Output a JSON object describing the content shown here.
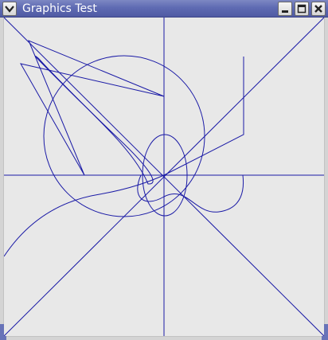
{
  "window": {
    "title": "Graphics Test"
  },
  "icons": {
    "menu": "chevron-down-icon",
    "minimize": "minimize-icon",
    "maximize": "maximize-icon",
    "close": "close-icon"
  },
  "colors": {
    "stroke": "#1a1aa6",
    "titlebar": "#5f6bb3",
    "canvas": "#e8e8e8"
  }
}
